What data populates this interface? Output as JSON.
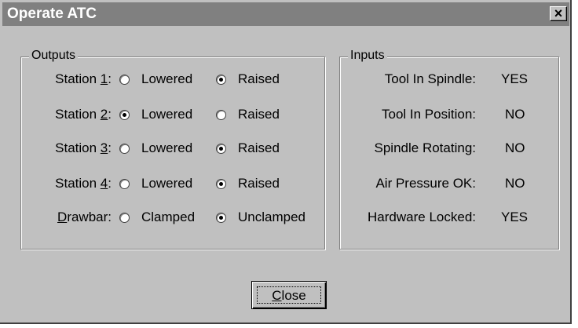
{
  "window": {
    "title": "Operate ATC",
    "close_glyph": "×"
  },
  "outputs": {
    "legend": "Outputs",
    "rows": [
      {
        "label_pre": "Station ",
        "label_key": "1",
        "label_post": ":",
        "opt1": "Lowered",
        "opt2": "Raised",
        "checked": 2
      },
      {
        "label_pre": "Station ",
        "label_key": "2",
        "label_post": ":",
        "opt1": "Lowered",
        "opt2": "Raised",
        "checked": 1
      },
      {
        "label_pre": "Station ",
        "label_key": "3",
        "label_post": ":",
        "opt1": "Lowered",
        "opt2": "Raised",
        "checked": 2
      },
      {
        "label_pre": "Station ",
        "label_key": "4",
        "label_post": ":",
        "opt1": "Lowered",
        "opt2": "Raised",
        "checked": 2
      },
      {
        "label_pre": "",
        "label_key": "D",
        "label_post": "rawbar:",
        "opt1": "Clamped",
        "opt2": "Unclamped",
        "checked": 2
      }
    ]
  },
  "inputs": {
    "legend": "Inputs",
    "rows": [
      {
        "label": "Tool In Spindle:",
        "value": "YES"
      },
      {
        "label": "Tool In Position:",
        "value": "NO"
      },
      {
        "label": "Spindle Rotating:",
        "value": "NO"
      },
      {
        "label": "Air Pressure OK:",
        "value": "NO"
      },
      {
        "label": "Hardware Locked:",
        "value": "YES"
      }
    ]
  },
  "close_button": {
    "key": "C",
    "rest": "lose"
  }
}
